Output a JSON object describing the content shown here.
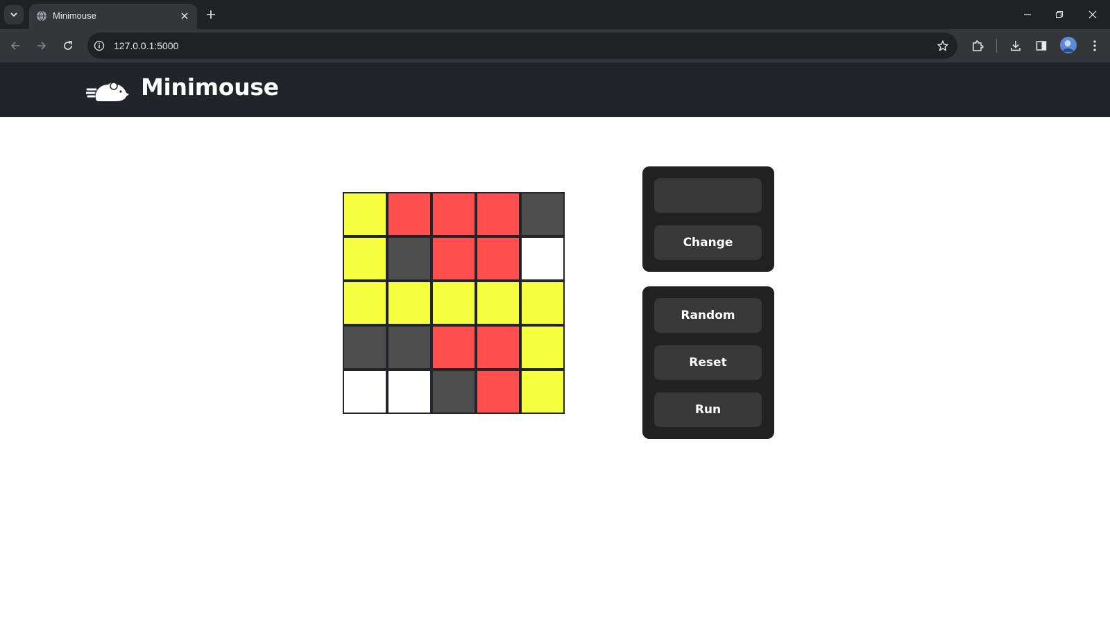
{
  "browser": {
    "tab_title": "Minimouse",
    "url": "127.0.0.1:5000"
  },
  "header": {
    "brand": "Minimouse",
    "logo_icon": "mouse-logo-icon"
  },
  "colors": {
    "yellow": "#f5ff3d",
    "red": "#ff4f4f",
    "gray": "#4d4d4d",
    "white": "#ffffff",
    "header_bg": "#212529",
    "panel_bg": "#212121",
    "button_bg": "#383838"
  },
  "grid": {
    "rows": [
      [
        "yellow",
        "red",
        "red",
        "red",
        "gray"
      ],
      [
        "yellow",
        "gray",
        "red",
        "red",
        "white"
      ],
      [
        "yellow",
        "yellow",
        "yellow",
        "yellow",
        "yellow"
      ],
      [
        "gray",
        "gray",
        "red",
        "red",
        "yellow"
      ],
      [
        "white",
        "white",
        "gray",
        "red",
        "yellow"
      ]
    ]
  },
  "controls": {
    "display_value": "",
    "change_label": "Change",
    "random_label": "Random",
    "reset_label": "Reset",
    "run_label": "Run"
  }
}
